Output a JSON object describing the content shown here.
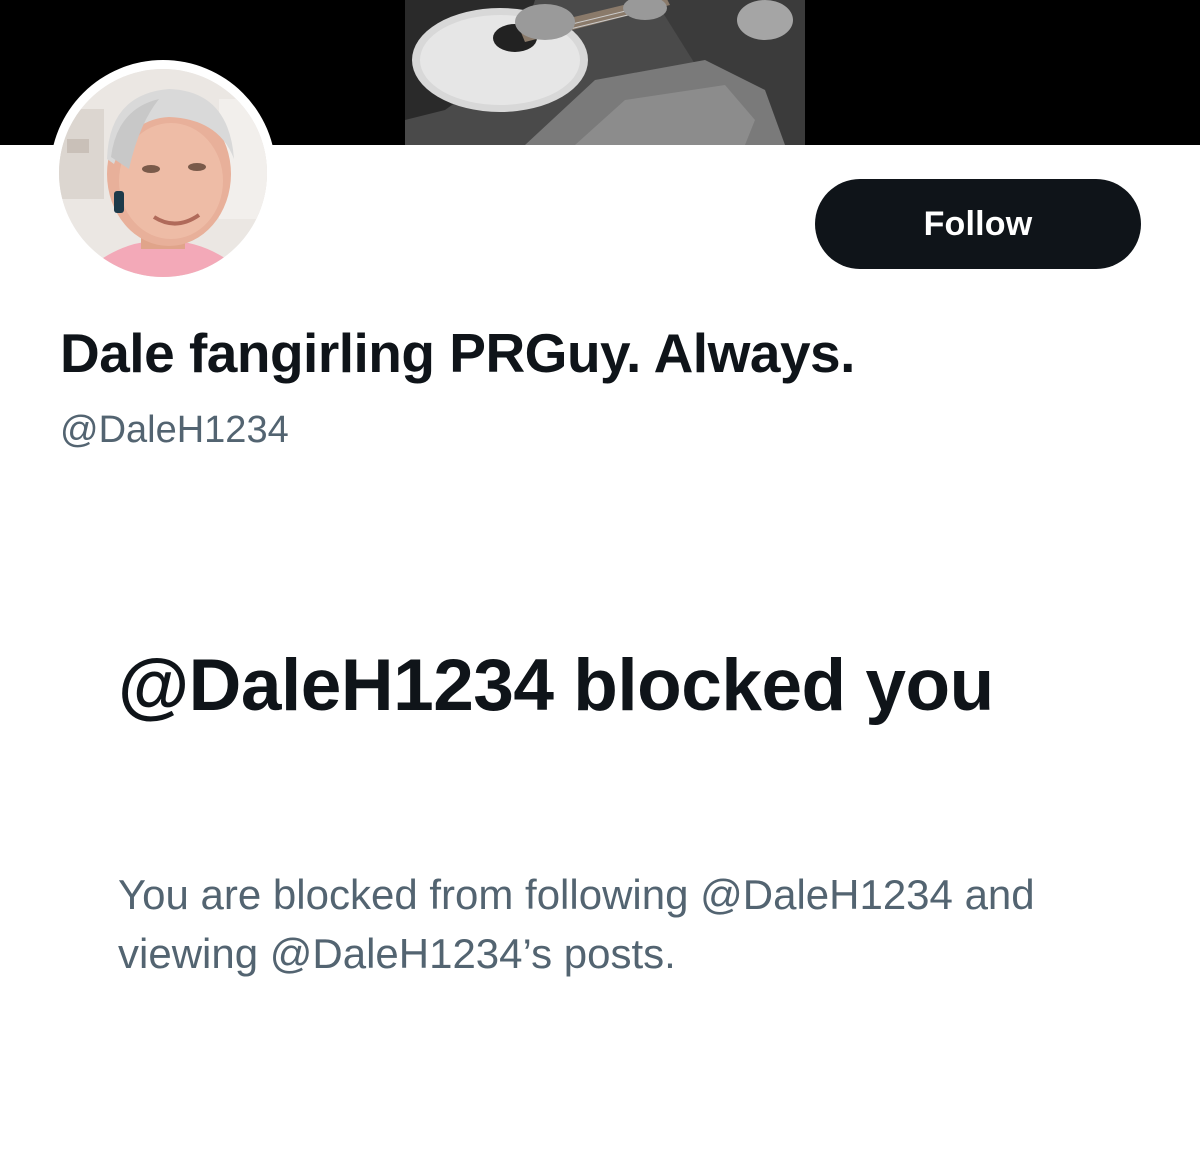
{
  "profile": {
    "display_name": "Dale fangirling PRGuy. Always.",
    "handle": "@DaleH1234",
    "follow_label": "Follow",
    "banner_image": "guitar-photo",
    "avatar_image": "profile-photo"
  },
  "blocked_notice": {
    "title": "@DaleH1234 blocked you",
    "description": "You are blocked from following @DaleH1234 and viewing @DaleH1234’s posts."
  },
  "colors": {
    "primary_text": "#0f1419",
    "secondary_text": "#536471",
    "button_bg": "#0f1419",
    "button_text": "#ffffff",
    "banner_bg": "#000000"
  }
}
